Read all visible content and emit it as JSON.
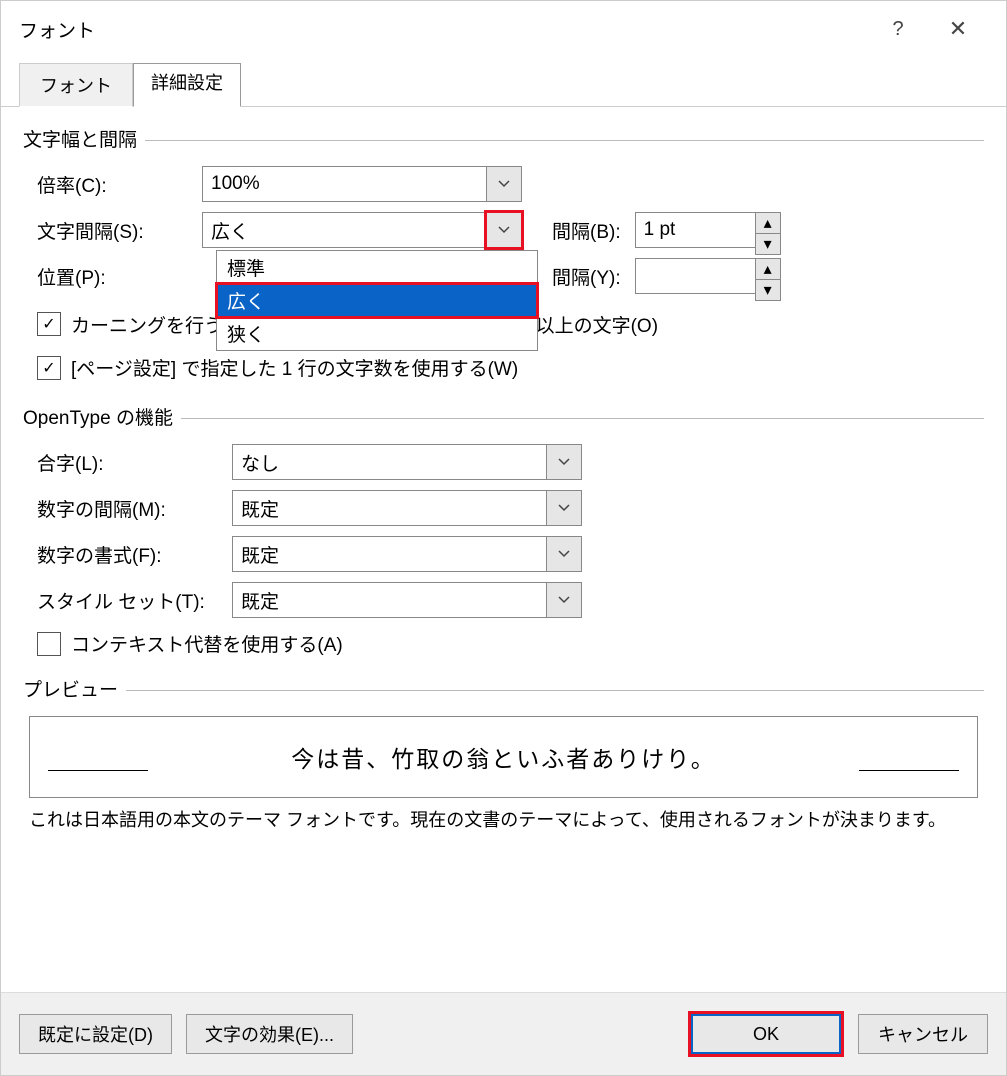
{
  "title": "フォント",
  "help_icon": "?",
  "close_icon": "✕",
  "tabs": {
    "font": "フォント",
    "advanced": "詳細設定"
  },
  "group1": {
    "title": "文字幅と間隔",
    "scale_label": "倍率(C):",
    "scale_value": "100%",
    "spacing_label": "文字間隔(S):",
    "spacing_value": "広く",
    "spacing_opts": {
      "normal": "標準",
      "wide": "広く",
      "narrow": "狭く"
    },
    "spacing_b_label": "間隔(B):",
    "spacing_b_value": "1 pt",
    "position_label": "位置(P):",
    "position_value": "",
    "spacing_y_label": "間隔(Y):",
    "spacing_y_value": "",
    "kerning_chk": "カーニングを行う(K):",
    "kerning_suffix": "ポイント以上の文字(O)",
    "line_chk": "[ページ設定] で指定した 1 行の文字数を使用する(W)"
  },
  "group2": {
    "title": "OpenType の機能",
    "ligature_label": "合字(L):",
    "ligature_value": "なし",
    "numspacing_label": "数字の間隔(M):",
    "numspacing_value": "既定",
    "numform_label": "数字の書式(F):",
    "numform_value": "既定",
    "styleset_label": "スタイル セット(T):",
    "styleset_value": "既定",
    "context_chk": "コンテキスト代替を使用する(A)"
  },
  "preview": {
    "title": "プレビュー",
    "text": "今は昔、竹取の翁といふ者ありけり。",
    "note": "これは日本語用の本文のテーマ フォントです。現在の文書のテーマによって、使用されるフォントが決まります。"
  },
  "footer": {
    "default": "既定に設定(D)",
    "effects": "文字の効果(E)...",
    "ok": "OK",
    "cancel": "キャンセル"
  }
}
